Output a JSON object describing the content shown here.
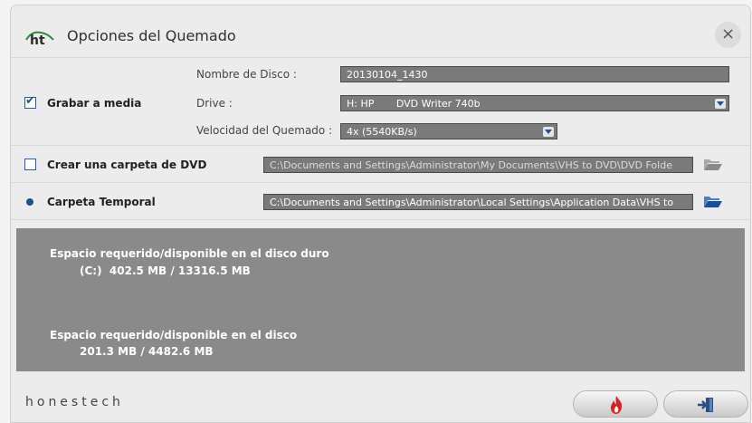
{
  "window": {
    "title": "Opciones del Quemado",
    "close_label": "×"
  },
  "burn_section": {
    "checkbox_label": "Grabar a media",
    "checked": true,
    "disc_name_label": "Nombre de Disco :",
    "disc_name_value": "20130104_1430",
    "drive_label": "Drive :",
    "drive_value": "H: HP       DVD Writer 740b",
    "speed_label": "Velocidad del Quemado :",
    "speed_value": "4x (5540KB/s)"
  },
  "dvd_folder_section": {
    "checkbox_label": "Crear una carpeta de DVD",
    "checked": false,
    "path": "C:\\Documents and Settings\\Administrator\\My Documents\\VHS to DVD\\DVD Folde"
  },
  "temp_folder_section": {
    "label": "Carpeta Temporal",
    "path": "C:\\Documents and Settings\\Administrator\\Local Settings\\Application Data\\VHS to"
  },
  "space_info": {
    "hdd_title": "Espacio requerido/disponible en el disco duro",
    "hdd_value": "(C:)  402.5 MB / 13316.5 MB",
    "disc_title": "Espacio requerido/disponible en el disco",
    "disc_value": "201.3 MB / 4482.6 MB"
  },
  "footer": {
    "brand": "honestech"
  },
  "icons": {
    "logo": "ht-logo",
    "close": "close-icon",
    "folder": "folder-open-icon",
    "burn": "fire-icon",
    "exit": "exit-icon"
  },
  "colors": {
    "accent": "#1e4e96",
    "field_bg": "#7a7a7a",
    "info_bg": "#8a8a8a",
    "burn_icon": "#e02020"
  }
}
